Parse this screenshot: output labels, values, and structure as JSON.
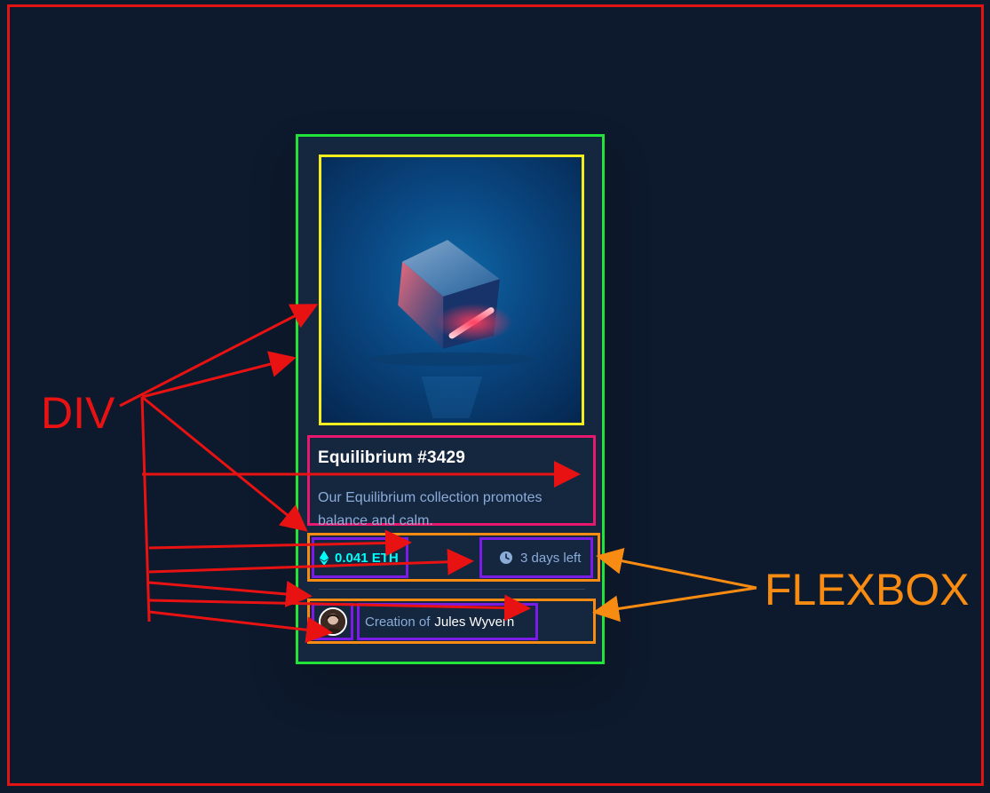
{
  "card": {
    "image_alt": "Equilibrium cube",
    "title": "Equilibrium #3429",
    "description": "Our Equilibrium collection promotes balance and calm.",
    "price": "0.041 ETH",
    "time_left": "3 days left",
    "creation_prefix": "Creation of",
    "creator": "Jules Wyvern",
    "icons": {
      "price": "ethereum-icon",
      "time": "clock-icon",
      "avatar": "avatar"
    }
  },
  "annotations": {
    "div_label": "DIV",
    "flexbox_label": "FLEXBOX"
  },
  "colors": {
    "background": "#0d192c",
    "card": "#15263f",
    "cyan": "#00fff8",
    "soft_blue": "#8bacd9",
    "white": "#ffffff",
    "outer_frame": "#e11313",
    "card_outline": "#22e33a",
    "image_outline": "#f5ee1e",
    "text_outline": "#e8186f",
    "flex_outline": "#f88b12",
    "item_outline": "#7a1be6"
  }
}
